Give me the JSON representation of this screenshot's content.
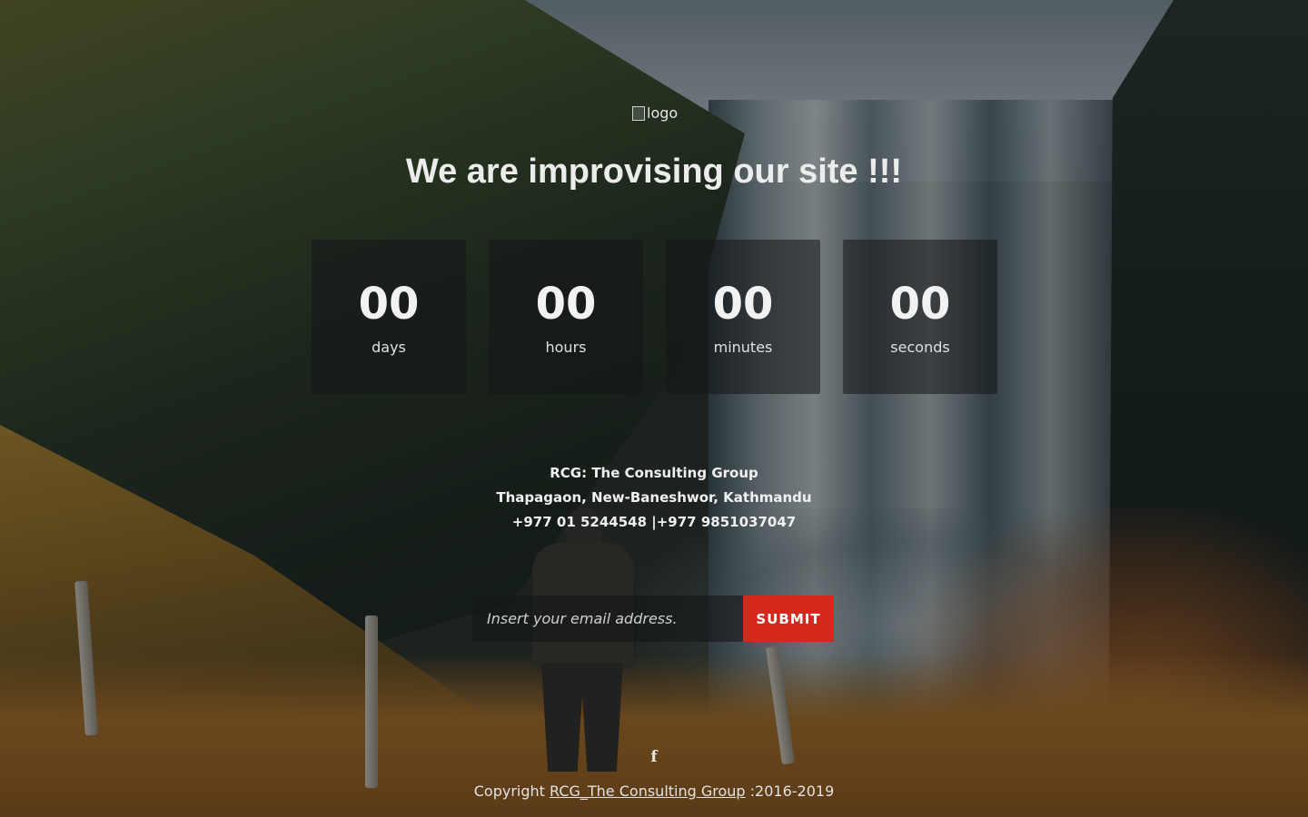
{
  "logo": {
    "alt_text": "logo"
  },
  "headline": "We are improvising our site !!!",
  "countdown": [
    {
      "value": "00",
      "label": "days"
    },
    {
      "value": "00",
      "label": "hours"
    },
    {
      "value": "00",
      "label": "minutes"
    },
    {
      "value": "00",
      "label": "seconds"
    }
  ],
  "contact": {
    "company": "RCG: The Consulting Group",
    "address": "Thapagaon, New-Baneshwor, Kathmandu",
    "phone": "+977 01 5244548 |+977 9851037047"
  },
  "subscribe": {
    "placeholder": "Insert your email address.",
    "submit_label": "SUBMIT"
  },
  "social": {
    "facebook_icon": "f"
  },
  "footer": {
    "prefix": "Copyright ",
    "link_text": "RCG_The Consulting Group",
    "suffix": " :2016-2019"
  },
  "colors": {
    "submit_bg": "#d5281c",
    "text": "#ececec"
  }
}
